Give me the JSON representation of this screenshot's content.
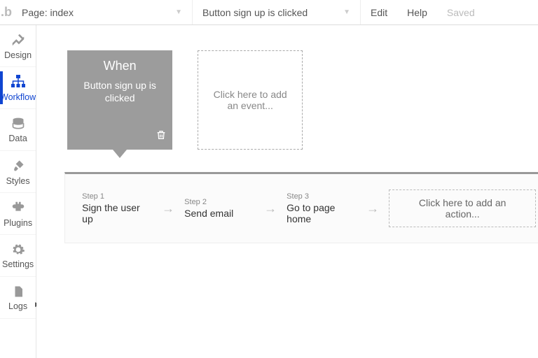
{
  "topbar": {
    "page_label": "Page: index",
    "workflow_label": "Button sign up is clicked",
    "edit": "Edit",
    "help": "Help",
    "saved": "Saved"
  },
  "sidebar": {
    "items": [
      {
        "label": "Design"
      },
      {
        "label": "Workflow"
      },
      {
        "label": "Data"
      },
      {
        "label": "Styles"
      },
      {
        "label": "Plugins"
      },
      {
        "label": "Settings"
      },
      {
        "label": "Logs"
      }
    ]
  },
  "events": {
    "selected": {
      "title": "When",
      "desc": "Button sign up is clicked"
    },
    "add_label": "Click here to add an event..."
  },
  "steps": {
    "list": [
      {
        "label": "Step 1",
        "title": "Sign the user up"
      },
      {
        "label": "Step 2",
        "title": "Send email"
      },
      {
        "label": "Step 3",
        "title": "Go to page home"
      }
    ],
    "add_label": "Click here to add an action..."
  }
}
